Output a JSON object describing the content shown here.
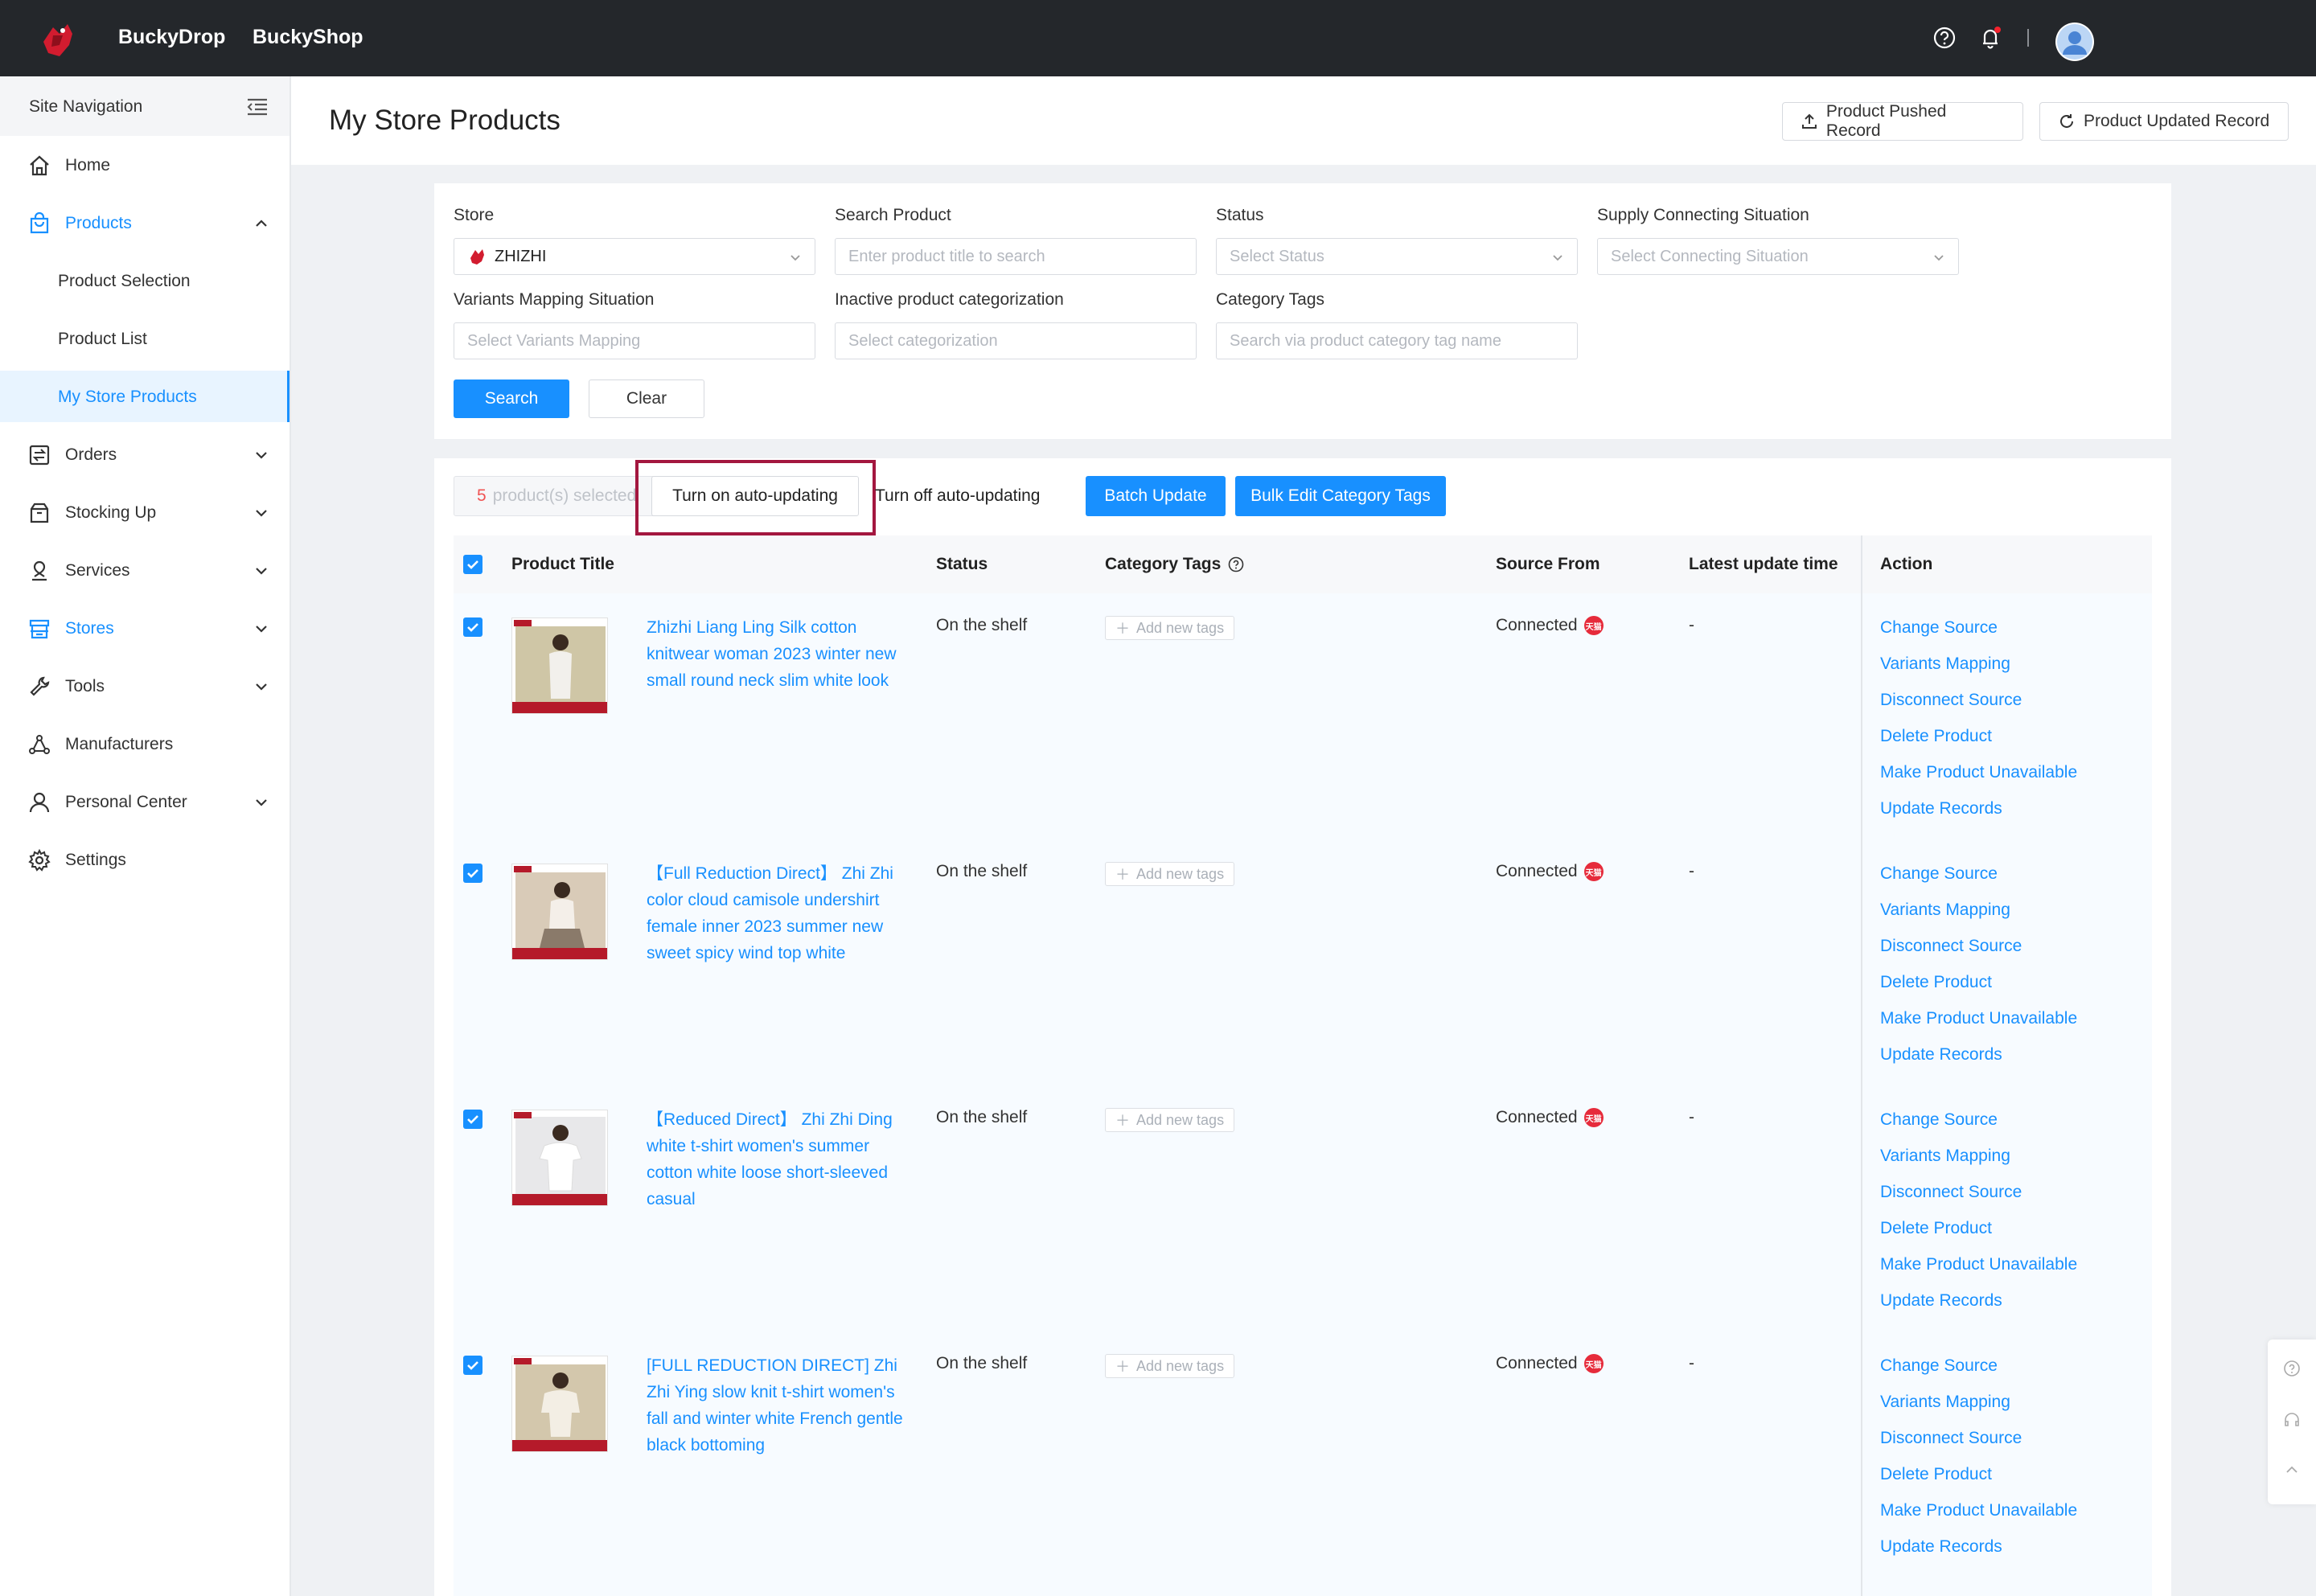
{
  "topbar": {
    "brand_1": "BuckyDrop",
    "brand_2": "BuckyShop",
    "icons": [
      "help-circle-icon",
      "bell-icon",
      "avatar"
    ]
  },
  "sidebar": {
    "header": "Site Navigation",
    "items": [
      {
        "label": "Home",
        "icon": "home-icon"
      },
      {
        "label": "Products",
        "icon": "bag-icon",
        "expanded": true
      },
      {
        "label": "Orders",
        "icon": "orders-icon"
      },
      {
        "label": "Stocking Up",
        "icon": "box-icon"
      },
      {
        "label": "Services",
        "icon": "services-icon"
      },
      {
        "label": "Stores",
        "icon": "store-icon"
      },
      {
        "label": "Tools",
        "icon": "wrench-icon"
      },
      {
        "label": "Manufacturers",
        "icon": "network-icon"
      },
      {
        "label": "Personal Center",
        "icon": "user-icon"
      },
      {
        "label": "Settings",
        "icon": "gear-icon"
      }
    ],
    "products_sub": [
      "Product Selection",
      "Product List",
      "My Store Products"
    ]
  },
  "header": {
    "title": "My Store Products",
    "pushed_btn": "Product Pushed Record",
    "updated_btn": "Product Updated Record"
  },
  "filters": {
    "store_label": "Store",
    "store_value": "ZHIZHI",
    "search_label": "Search Product",
    "search_placeholder": "Enter product title to search",
    "status_label": "Status",
    "status_placeholder": "Select Status",
    "supply_label": "Supply Connecting Situation",
    "supply_placeholder": "Select Connecting Situation",
    "variants_label": "Variants Mapping Situation",
    "variants_placeholder": "Select Variants Mapping",
    "inactive_label": "Inactive product categorization",
    "inactive_placeholder": "Select categorization",
    "tags_label": "Category Tags",
    "tags_placeholder": "Search via product category tag name",
    "search_btn": "Search",
    "clear_btn": "Clear"
  },
  "toolbar": {
    "selected_num": "5",
    "selected_text": "product(s) selected",
    "auto_on": "Turn on auto-updating",
    "auto_off": "Turn off auto-updating",
    "batch_update": "Batch Update",
    "bulk_edit": "Bulk Edit Category Tags"
  },
  "table": {
    "columns": [
      "Product Title",
      "Status",
      "Category Tags",
      "Source From",
      "Latest update time",
      "Action"
    ],
    "add_tag_label": "Add new tags",
    "tmall_badge": "天猫",
    "actions": [
      "Change Source",
      "Variants Mapping",
      "Disconnect Source",
      "Delete Product",
      "Make Product Unavailable",
      "Update Records"
    ],
    "rows": [
      {
        "title": "Zhizhi Liang Ling Silk cotton knitwear woman 2023 winter new small round neck slim white look",
        "status": "On the shelf",
        "source": "Connected",
        "latest": "-"
      },
      {
        "title": "【Full Reduction Direct】 Zhi Zhi color cloud camisole undershirt female inner 2023 summer new sweet spicy wind top white",
        "status": "On the shelf",
        "source": "Connected",
        "latest": "-"
      },
      {
        "title": "【Reduced Direct】 Zhi Zhi Ding white t-shirt women's summer cotton white loose short-sleeved casual",
        "status": "On the shelf",
        "source": "Connected",
        "latest": "-"
      },
      {
        "title": "[FULL REDUCTION DIRECT] Zhi Zhi Ying slow knit t-shirt women's fall and winter white French gentle black bottoming",
        "status": "On the shelf",
        "source": "Connected",
        "latest": "-"
      }
    ]
  },
  "colors": {
    "accent": "#1890ff",
    "topbar": "#24272b",
    "highlight": "#a3173f"
  }
}
